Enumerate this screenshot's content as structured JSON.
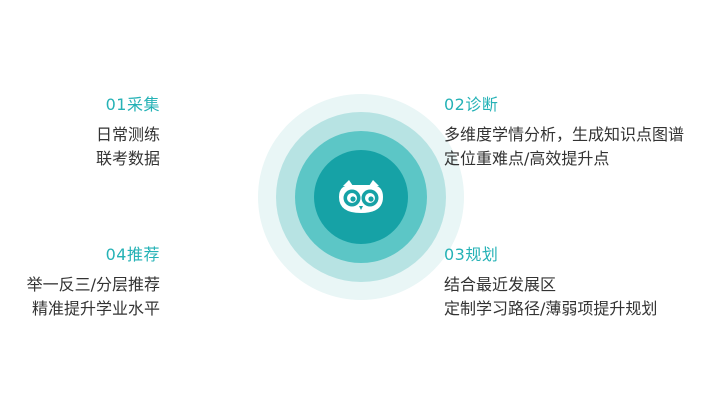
{
  "center": {
    "logo_icon": "owl-icon",
    "colors": {
      "outer_ring": "#e9f6f6",
      "middle_ring": "#b7e3e3",
      "inner_ring": "#5cc6c6",
      "core": "#16a2a6"
    }
  },
  "steps": [
    {
      "title": "01采集",
      "lines": [
        "日常测练",
        "联考数据"
      ]
    },
    {
      "title": "02诊断",
      "lines": [
        "多维度学情分析，生成知识点图谱",
        "定位重难点/高效提升点"
      ]
    },
    {
      "title": "03规划",
      "lines": [
        "结合最近发展区",
        "定制学习路径/薄弱项提升规划"
      ]
    },
    {
      "title": "04推荐",
      "lines": [
        "举一反三/分层推荐",
        "精准提升学业水平"
      ]
    }
  ],
  "accent_color": "#25b2b6"
}
